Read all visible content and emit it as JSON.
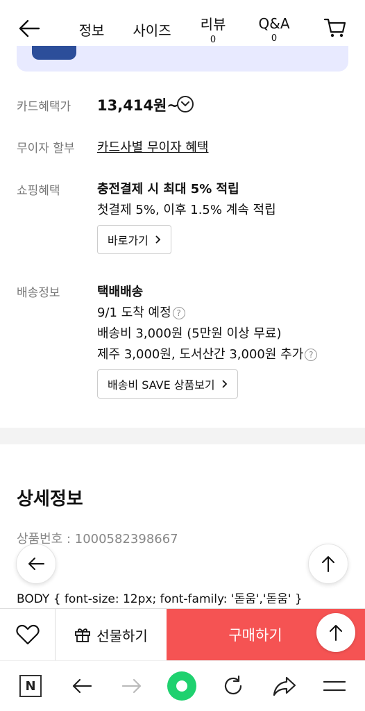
{
  "header": {
    "tabs": [
      {
        "label": "정보",
        "count": ""
      },
      {
        "label": "사이즈",
        "count": ""
      },
      {
        "label": "리뷰",
        "count": "0"
      },
      {
        "label": "Q&A",
        "count": "0"
      }
    ]
  },
  "info": {
    "card_label": "카드혜택가",
    "card_price": "13,414원~",
    "installment_label": "무이자 할부",
    "installment_link": "카드사별 무이자 혜택",
    "shopping_label": "쇼핑혜택",
    "shopping_title": "충전결제 시 최대 5% 적립",
    "shopping_desc": "첫결제 5%, 이후 1.5% 계속 적립",
    "shopping_button": "바로가기",
    "delivery_label": "배송정보",
    "delivery_title": "택배배송",
    "delivery_eta": "9/1 도착 예정",
    "delivery_fee": "배송비 3,000원 (5만원 이상 무료)",
    "delivery_extra": "제주 3,000원, 도서산간 3,000원 추가",
    "delivery_button": "배송비 SAVE 상품보기"
  },
  "detail": {
    "title": "상세정보",
    "product_no": "상품번호 : 1000582398667",
    "body_text": "BODY { font-size: 12px; font-family: '돋움','돋움' }"
  },
  "buy_bar": {
    "gift_label": "선물하기",
    "buy_label": "구매하기"
  },
  "colors": {
    "buy": "#f55353",
    "banner": "#e8eaff",
    "naver_green": "#1fd16f"
  }
}
